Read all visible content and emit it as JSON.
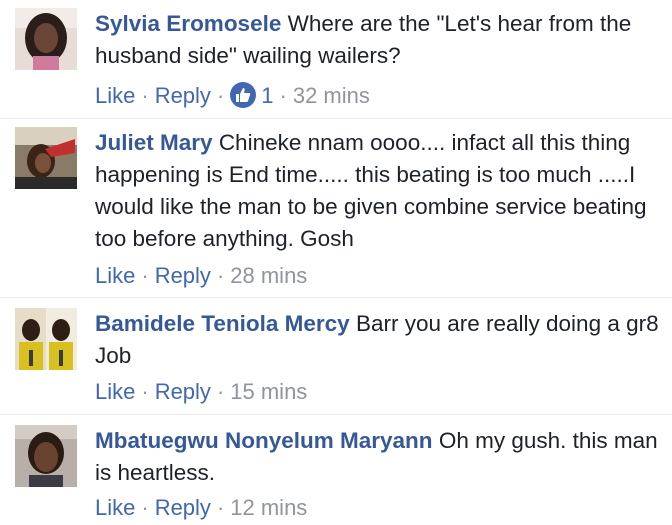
{
  "comments": [
    {
      "author": "Sylvia Eromosele",
      "text": "Where are the \"Let's hear from the husband side\" wailing wailers?",
      "like_label": "Like",
      "reply_label": "Reply",
      "likes": "1",
      "time": "32 mins"
    },
    {
      "author": "Juliet Mary",
      "text": "Chineke nnam oooo.... infact all this thing happening is End time..... this beating is too much .....I would like the man to be given combine service beating too before anything. Gosh",
      "like_label": "Like",
      "reply_label": "Reply",
      "time": "28 mins"
    },
    {
      "author": "Bamidele Teniola Mercy",
      "text": "Barr you are really doing a gr8 Job",
      "like_label": "Like",
      "reply_label": "Reply",
      "time": "15 mins"
    },
    {
      "author": "Mbatuegwu Nonyelum Maryann",
      "text": "Oh my gush. this man is heartless.",
      "like_label": "Like",
      "reply_label": "Reply",
      "time": "12 mins"
    }
  ],
  "colors": {
    "author_link": "#365899",
    "action_link": "#4267b2",
    "meta_text": "#90949c",
    "like_badge": "#4267b2"
  }
}
